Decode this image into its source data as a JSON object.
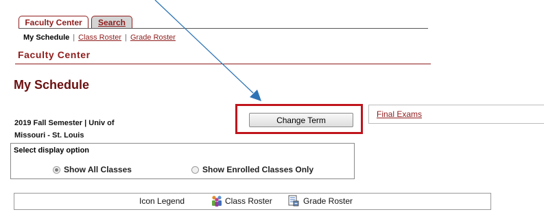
{
  "tabs": {
    "faculty_center": "Faculty Center",
    "search": "Search"
  },
  "subnav": {
    "current": "My Schedule",
    "separator": "|",
    "class_roster": "Class Roster",
    "grade_roster": "Grade Roster"
  },
  "section_header": "Faculty Center",
  "page_title": "My Schedule",
  "term": {
    "line1": "2019 Fall Semester | Univ of",
    "line2": "Missouri - St. Louis"
  },
  "change_term_label": "Change Term",
  "final_exams_label": "Final Exams",
  "display_option": {
    "title": "Select display option",
    "show_all": "Show All Classes",
    "show_enrolled": "Show Enrolled Classes Only",
    "selected": "show_all"
  },
  "legend": {
    "title": "Icon Legend",
    "class_roster": "Class Roster",
    "grade_roster": "Grade Roster"
  },
  "colors": {
    "accent": "#8e1b1b",
    "highlight": "#c0141c",
    "arrow": "#2e74b5"
  }
}
